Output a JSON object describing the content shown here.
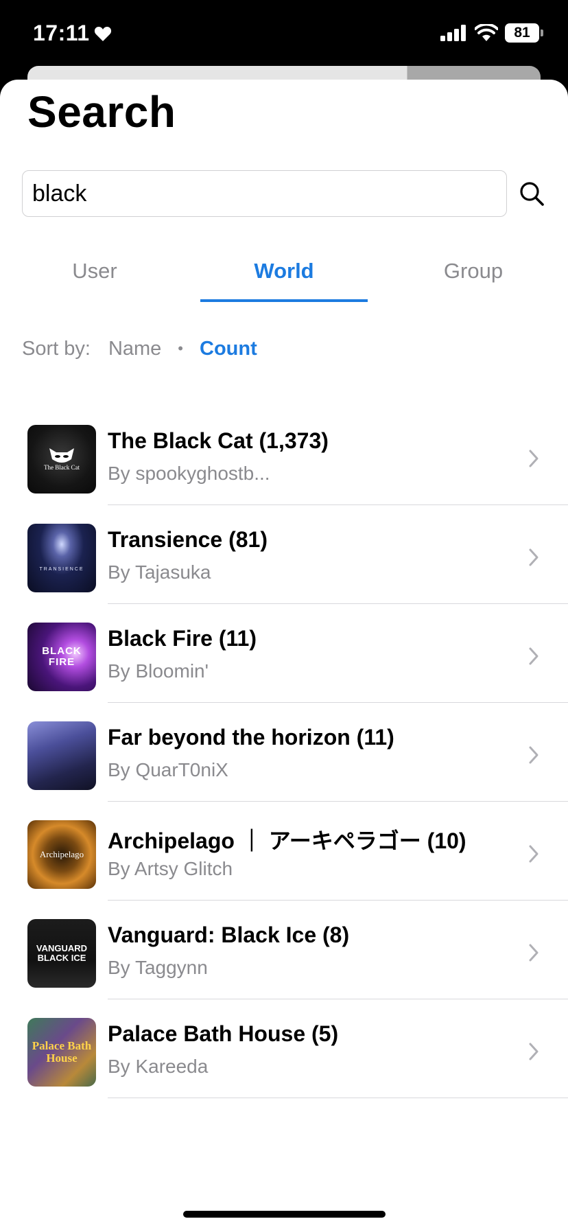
{
  "status_bar": {
    "time": "17:11",
    "battery": "81"
  },
  "page": {
    "title": "Search"
  },
  "search": {
    "value": "black",
    "placeholder": ""
  },
  "tabs": [
    {
      "label": "User",
      "active": false
    },
    {
      "label": "World",
      "active": true
    },
    {
      "label": "Group",
      "active": false
    }
  ],
  "sort": {
    "label": "Sort by:",
    "options": [
      {
        "label": "Name",
        "active": false
      },
      {
        "label": "Count",
        "active": true
      }
    ]
  },
  "worlds": [
    {
      "title": "The Black Cat (1,373)",
      "author": "By spookyghostb...",
      "thumb_text": "The Black Cat"
    },
    {
      "title": "Transience (81)",
      "author": "By Tajasuka",
      "thumb_text": "TRANSIENCE"
    },
    {
      "title": "Black Fire (11)",
      "author": "By Bloomin'",
      "thumb_text": "BLACK FIRE"
    },
    {
      "title": "Far beyond the horizon (11)",
      "author": "By QuarT0niX",
      "thumb_text": ""
    },
    {
      "title": "Archipelago ｜ アーキペラゴー (10)",
      "author": "By Artsy Glitch",
      "thumb_text": "Archipelago"
    },
    {
      "title": "Vanguard: Black Ice (8)",
      "author": "By Taggynn",
      "thumb_text": "VANGUARD BLACK ICE"
    },
    {
      "title": "Palace Bath House (5)",
      "author": "By Kareeda",
      "thumb_text": "Palace Bath House"
    }
  ],
  "colors": {
    "accent": "#1c7be0",
    "secondary_text": "#8a8a8e",
    "divider": "#d8d8dc"
  },
  "icons": {
    "search": "search-icon",
    "row_chevron": "chevron-right-icon",
    "status_heart": "heart-icon"
  }
}
